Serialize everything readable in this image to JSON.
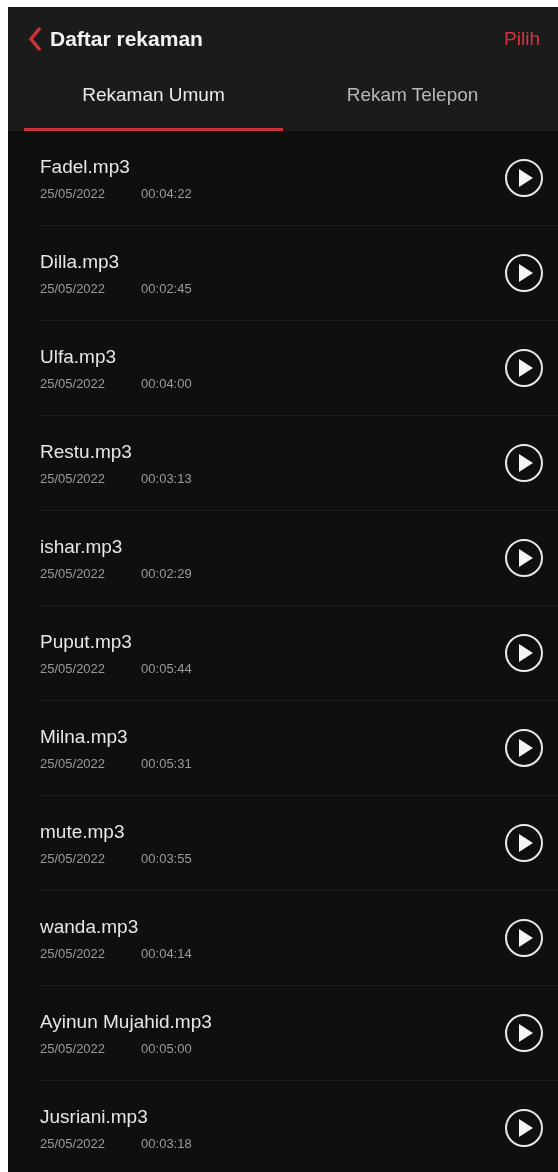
{
  "header": {
    "title": "Daftar rekaman",
    "action": "Pilih"
  },
  "tabs": [
    {
      "label": "Rekaman Umum",
      "selected": true
    },
    {
      "label": "Rekam Telepon",
      "selected": false
    }
  ],
  "recordings": [
    {
      "name": "Fadel.mp3",
      "date": "25/05/2022",
      "duration": "00:04:22"
    },
    {
      "name": "Dilla.mp3",
      "date": "25/05/2022",
      "duration": "00:02:45"
    },
    {
      "name": "Ulfa.mp3",
      "date": "25/05/2022",
      "duration": "00:04:00"
    },
    {
      "name": "Restu.mp3",
      "date": "25/05/2022",
      "duration": "00:03:13"
    },
    {
      "name": "ishar.mp3",
      "date": "25/05/2022",
      "duration": "00:02:29"
    },
    {
      "name": "Puput.mp3",
      "date": "25/05/2022",
      "duration": "00:05:44"
    },
    {
      "name": "Milna.mp3",
      "date": "25/05/2022",
      "duration": "00:05:31"
    },
    {
      "name": "mute.mp3",
      "date": "25/05/2022",
      "duration": "00:03:55"
    },
    {
      "name": "wanda.mp3",
      "date": "25/05/2022",
      "duration": "00:04:14"
    },
    {
      "name": "Ayinun Mujahid.mp3",
      "date": "25/05/2022",
      "duration": "00:05:00"
    },
    {
      "name": "Jusriani.mp3",
      "date": "25/05/2022",
      "duration": "00:03:18"
    }
  ]
}
